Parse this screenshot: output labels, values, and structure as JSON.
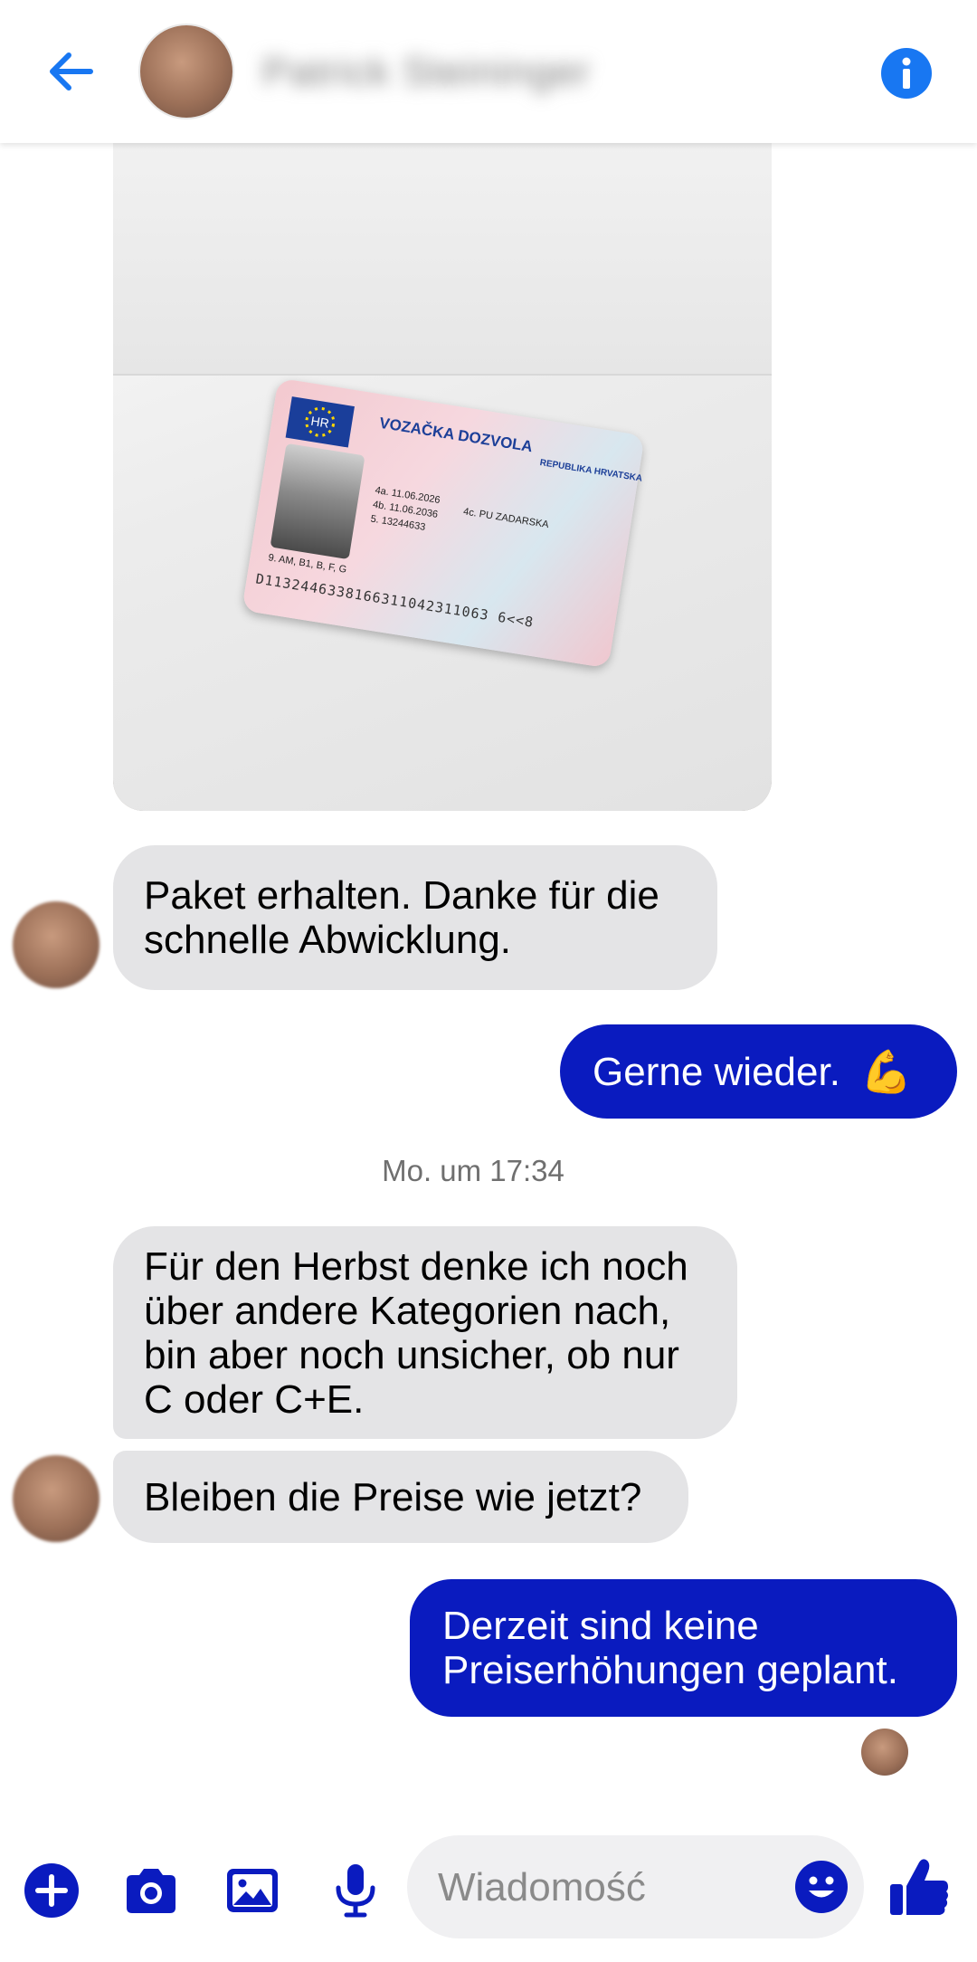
{
  "header": {
    "contact_name": "Patrick Steininger",
    "back_icon": "back-arrow-icon",
    "info_icon": "info-icon",
    "accent": "#1877f2"
  },
  "photo_message": {
    "card_title": "VOZAČKA DOZVOLA",
    "card_country": "REPUBLIKA HRVATSKA",
    "card_country_code": "HR",
    "field_4a": "4a. 11.06.2026",
    "field_4b": "4b. 11.06.2036",
    "field_4c": "4c. PU ZADARSKA",
    "field_5": "5. 13244633",
    "field_9": "9. AM, B1, B, F, G",
    "mrz": "D1132446338166311042311063 6<<8"
  },
  "messages": [
    {
      "direction": "in",
      "text_line1": "Paket erhalten. Danke für die",
      "text_line2": "schnelle Abwicklung."
    },
    {
      "direction": "out",
      "text": "Gerne wieder.",
      "emoji": "💪"
    },
    {
      "direction": "in",
      "line1": "Für den Herbst denke ich noch",
      "line2": "über andere Kategorien nach,",
      "line3": "bin aber noch unsicher, ob nur",
      "line4": "C oder C+E."
    },
    {
      "direction": "in",
      "text": "Bleiben die Preise wie jetzt?"
    },
    {
      "direction": "out",
      "text_line1": "Derzeit sind keine",
      "text_line2": "Preiserhöhungen geplant."
    }
  ],
  "timestamp": "Mo. um 17:34",
  "composer": {
    "placeholder": "Wiadomość",
    "icons": [
      "plus-icon",
      "camera-icon",
      "gallery-icon",
      "microphone-icon",
      "emoji-icon",
      "thumbs-up-icon"
    ],
    "accent": "#0a1bbf"
  },
  "colors": {
    "incoming_bubble": "#e4e4e6",
    "outgoing_bubble": "#0a1bbf",
    "header_accent": "#1877f2"
  }
}
